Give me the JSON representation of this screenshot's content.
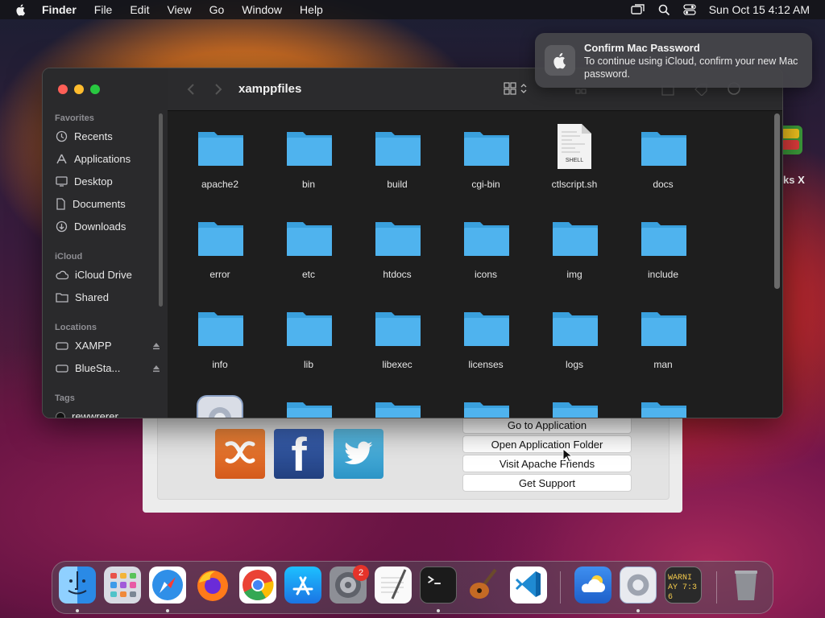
{
  "menubar": {
    "items": [
      "Finder",
      "File",
      "Edit",
      "View",
      "Go",
      "Window",
      "Help"
    ],
    "clock": "Sun Oct 15  4:12 AM"
  },
  "notification": {
    "title": "Confirm Mac Password",
    "body": "To continue using iCloud, confirm your new Mac password."
  },
  "finder": {
    "title": "xamppfiles",
    "sidebar": {
      "favorites_header": "Favorites",
      "favorites": [
        {
          "label": "Recents",
          "icon": "clock-icon"
        },
        {
          "label": "Applications",
          "icon": "applications-icon"
        },
        {
          "label": "Desktop",
          "icon": "desktop-icon"
        },
        {
          "label": "Documents",
          "icon": "document-icon"
        },
        {
          "label": "Downloads",
          "icon": "download-icon"
        }
      ],
      "icloud_header": "iCloud",
      "icloud": [
        {
          "label": "iCloud Drive",
          "icon": "cloud-icon"
        },
        {
          "label": "Shared",
          "icon": "shared-folder-icon"
        }
      ],
      "locations_header": "Locations",
      "locations": [
        {
          "label": "XAMPP",
          "icon": "disk-icon"
        },
        {
          "label": "BlueSta...",
          "icon": "disk-icon"
        }
      ],
      "tags_header": "Tags",
      "tags": [
        {
          "label": "rewwrerer",
          "color": "#111111"
        }
      ]
    },
    "files": [
      "apache2",
      "bin",
      "build",
      "cgi-bin",
      "ctlscript.sh",
      "docs",
      "error",
      "etc",
      "htdocs",
      "icons",
      "img",
      "include",
      "info",
      "lib",
      "libexec",
      "licenses",
      "logs",
      "man"
    ],
    "shell_badge": "SHELL"
  },
  "xampp": {
    "buttons": [
      "Go to Application",
      "Open Application Folder",
      "Visit Apache Friends",
      "Get Support"
    ],
    "xampp_logo_label": "xampp-logo",
    "facebook_glyph": "f"
  },
  "desktop": {
    "partial_label": "ks X"
  },
  "dock": {
    "apps": [
      "Finder",
      "Launchpad",
      "Safari",
      "Firefox",
      "Chrome",
      "App Store",
      "System Preferences",
      "TextEdit",
      "Terminal",
      "GarageBand",
      "VS Code",
      "Weather",
      "System Settings",
      "Console",
      "Trash"
    ],
    "badge": "2",
    "console_text": "WARNI AY 7:36"
  },
  "colors": {
    "folder": "#4fb3ee",
    "folder_tab": "#3aa0dd",
    "window_bg": "#1e1e1e",
    "sidebar_bg": "#2a2a2c"
  }
}
